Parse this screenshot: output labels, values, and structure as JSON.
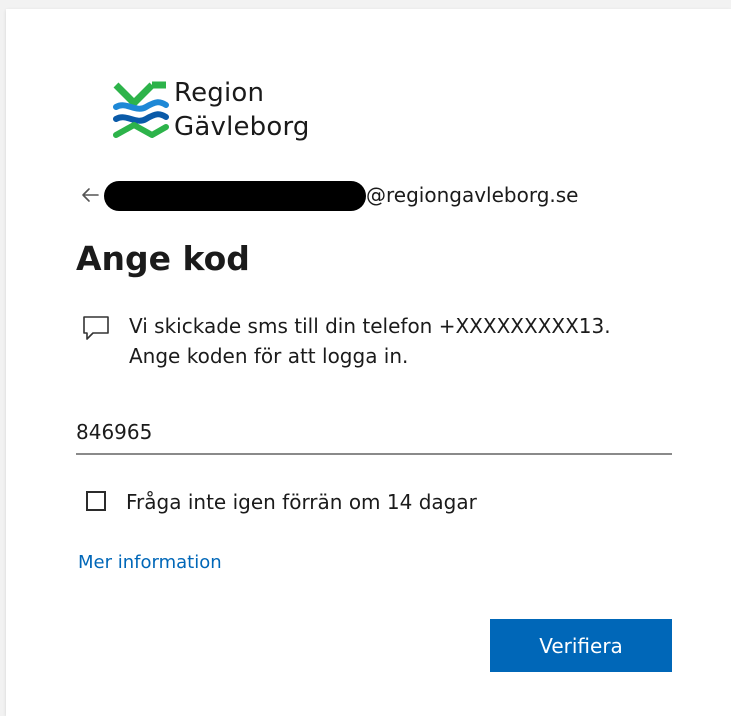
{
  "branding": {
    "logo_line1": "Region",
    "logo_line2": "Gävleborg",
    "logo_icon": "region-gavleborg-logo-icon",
    "colors": {
      "green": "#2db34a",
      "blue": "#1e88d6",
      "dark_blue": "#0a5aa8"
    }
  },
  "identity": {
    "back_icon": "back-arrow-icon",
    "email_domain": "@regiongavleborg.se"
  },
  "page": {
    "title": "Ange kod"
  },
  "sms_message": {
    "icon": "sms-message-icon",
    "line1": "Vi skickade sms till din telefon +XXXXXXXXX13.",
    "line2": "Ange koden för att logga in."
  },
  "code_input": {
    "value": "846965"
  },
  "remember": {
    "checked": false,
    "label": "Fråga inte igen förrän om 14 dagar"
  },
  "links": {
    "more_info": "Mer information"
  },
  "actions": {
    "verify_label": "Verifiera",
    "accent_color": "#0067b8"
  }
}
